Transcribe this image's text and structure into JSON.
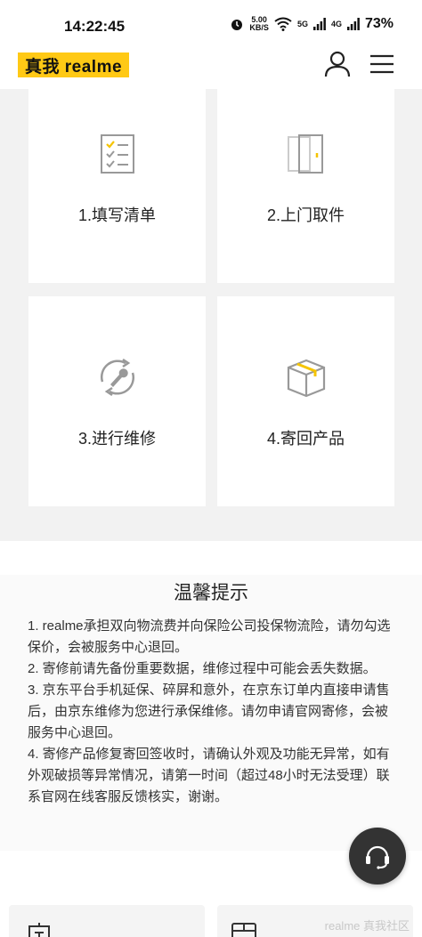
{
  "status_bar": {
    "time": "14:22:45",
    "speed_value": "5.00",
    "speed_unit": "KB/S",
    "signal1": "5G",
    "signal2": "4G",
    "battery": "73%"
  },
  "header": {
    "logo_text": "真我 realme",
    "brand_color": "#ffc915"
  },
  "steps": [
    {
      "label": "1.填写清单",
      "icon": "checklist-icon"
    },
    {
      "label": "2.上门取件",
      "icon": "door-icon"
    },
    {
      "label": "3.进行维修",
      "icon": "repair-wrench-icon"
    },
    {
      "label": "4.寄回产品",
      "icon": "package-box-icon"
    }
  ],
  "tips": {
    "title": "温馨提示",
    "items": [
      "1. realme承担双向物流费并向保险公司投保物流险，请勿勾选保价，会被服务中心退回。",
      "2. 寄修前请先备份重要数据，维修过程中可能会丢失数据。",
      "3. 京东平台手机延保、碎屏和意外，在京东订单内直接申请售后，由京东维修为您进行承保维修。请勿申请官网寄修，会被服务中心退回。",
      "4. 寄修产品修复寄回签收时，请确认外观及功能无异常，如有外观破损等异常情况，请第一时间（超过48小时无法受理）联系官网在线客服反馈核实，谢谢。"
    ]
  },
  "floating": {
    "icon": "customer-service-headset-icon"
  },
  "watermark": "realme 真我社区"
}
